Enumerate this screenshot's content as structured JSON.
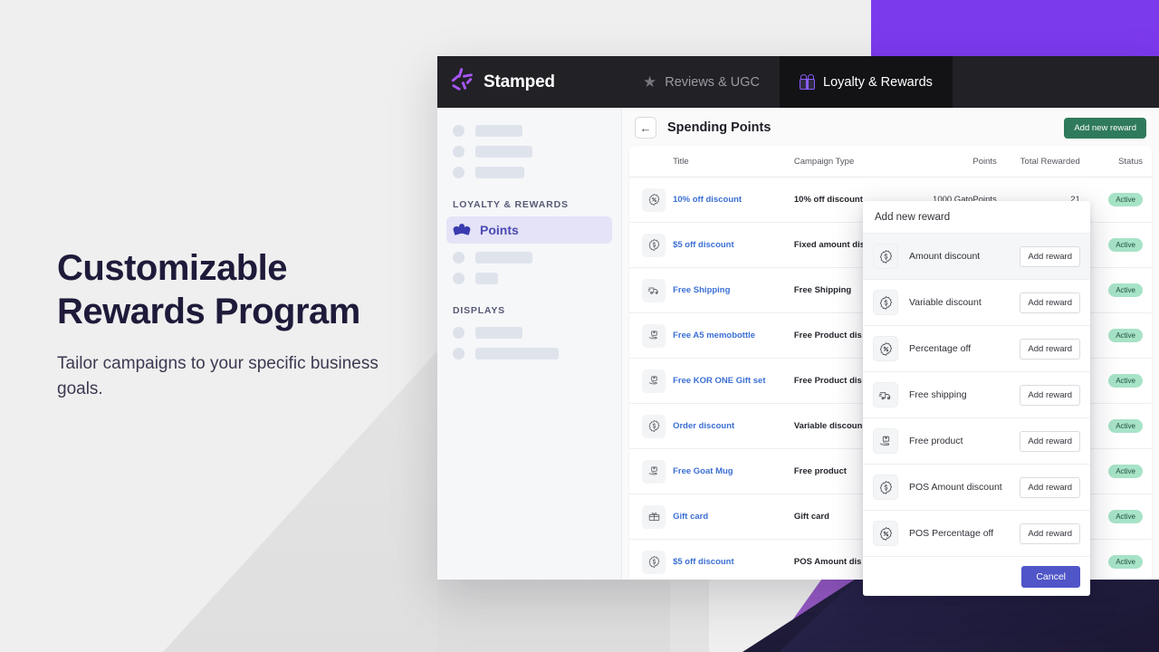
{
  "promo": {
    "heading_line1": "Customizable",
    "heading_line2": "Rewards Program",
    "subtext": "Tailor campaigns to your specific business goals."
  },
  "topnav": {
    "brand": "Stamped",
    "tabs": [
      {
        "label": "Reviews & UGC",
        "icon": "star-icon",
        "active": false
      },
      {
        "label": "Loyalty & Rewards",
        "icon": "gift-icon",
        "active": true
      }
    ]
  },
  "sidebar": {
    "sections": [
      {
        "label": "LOYALTY & REWARDS"
      },
      {
        "label": "DISPLAYS"
      }
    ],
    "active_item": {
      "label": "Points",
      "icon": "hands-points-icon",
      "status_dot": "#2ebd4e"
    }
  },
  "main": {
    "back_icon": "arrow-left-icon",
    "page_title": "Spending Points",
    "add_new_reward_label": "Add new reward",
    "table": {
      "columns": [
        "Title",
        "Campaign Type",
        "Points",
        "Total Rewarded",
        "Status"
      ],
      "rows": [
        {
          "icon": "percent-badge-icon",
          "title": "10% off discount",
          "type": "10% off discount",
          "points": "1000 GatoPoints",
          "rewarded": "21",
          "status": "Active"
        },
        {
          "icon": "dollar-badge-icon",
          "title": "$5 off discount",
          "type": "Fixed amount dis",
          "points": "",
          "rewarded": "",
          "status": "Active"
        },
        {
          "icon": "truck-icon",
          "title": "Free Shipping",
          "type": "Free Shipping",
          "points": "",
          "rewarded": "",
          "status": "Active"
        },
        {
          "icon": "hand-box-icon",
          "title": "Free A5 memobottle",
          "type": "Free Product dis",
          "points": "",
          "rewarded": "",
          "status": "Active"
        },
        {
          "icon": "hand-box-icon",
          "title": "Free KOR ONE Gift set",
          "type": "Free Product dis",
          "points": "",
          "rewarded": "",
          "status": "Active"
        },
        {
          "icon": "dollar-badge-icon",
          "title": "Order discount",
          "type": "Variable discoun",
          "points": "",
          "rewarded": "",
          "status": "Active"
        },
        {
          "icon": "hand-box-icon",
          "title": "Free Goat Mug",
          "type": "Free product",
          "points": "",
          "rewarded": "",
          "status": "Active"
        },
        {
          "icon": "gift-card-icon",
          "title": "Gift card",
          "type": "Gift card",
          "points": "",
          "rewarded": "",
          "status": "Active"
        },
        {
          "icon": "dollar-badge-icon",
          "title": "$5 off discount",
          "type": "POS Amount dis",
          "points": "",
          "rewarded": "",
          "status": "Active"
        }
      ]
    }
  },
  "modal": {
    "title": "Add new reward",
    "cancel_label": "Cancel",
    "items": [
      {
        "icon": "dollar-badge-icon",
        "label": "Amount discount",
        "action": "Add reward",
        "highlighted": true
      },
      {
        "icon": "dollar-badge-icon",
        "label": "Variable discount",
        "action": "Add reward",
        "highlighted": false
      },
      {
        "icon": "percent-badge-icon",
        "label": "Percentage off",
        "action": "Add reward",
        "highlighted": false
      },
      {
        "icon": "truck-icon",
        "label": "Free shipping",
        "action": "Add reward",
        "highlighted": false
      },
      {
        "icon": "hand-box-icon",
        "label": "Free product",
        "action": "Add reward",
        "highlighted": false
      },
      {
        "icon": "dollar-badge-icon",
        "label": "POS Amount discount",
        "action": "Add reward",
        "highlighted": false
      },
      {
        "icon": "percent-badge-icon",
        "label": "POS Percentage off",
        "action": "Add reward",
        "highlighted": false
      }
    ]
  },
  "colors": {
    "brand_purple": "#7c3aed",
    "nav_dark": "#212126",
    "accent_green": "#2f7a5c",
    "badge_green": "#a7e3c7",
    "link_blue": "#3b6fd4",
    "cancel_blue": "#5055c8",
    "sidebar_active": "#e4e3f7"
  }
}
